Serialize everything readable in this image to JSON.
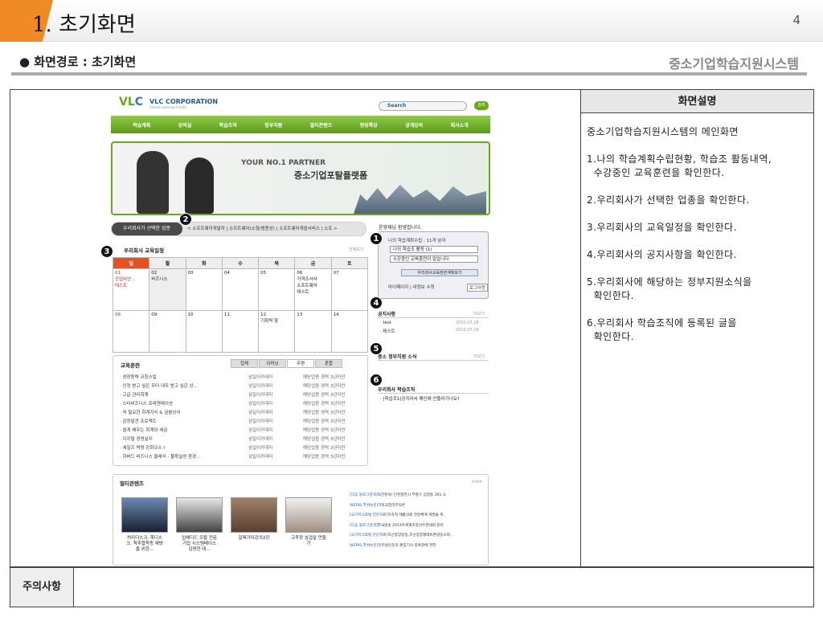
{
  "slide": {
    "title": "1. 초기화면",
    "page": "4",
    "path": "● 화면경로 : 초기화면",
    "system": "중소기업학습지원시스템"
  },
  "desc": {
    "header": "화면설명",
    "lines": [
      "중소기업학습지원시스템의 메인화면",
      "1.나의 학습계획수립현황, 학습조 활동내역,\n  수강중인 교육훈련을 확인한다.",
      "2.우리회사가 선택한 업종을 확인한다.",
      "3.우리회사의 교육일정을 확인한다.",
      "4.우리회사의 공지사항을 확인한다.",
      "5.우리회사에 해당하는 정부지원소식을\n  확인한다.",
      "6.우리회사 학습조직에 등록된 글을\n  확인한다."
    ]
  },
  "note": {
    "label": "주의사항"
  },
  "markers": [
    "1",
    "2",
    "3",
    "4",
    "5",
    "6"
  ],
  "site": {
    "logo_a": "VL",
    "logo_b": "C",
    "corp": "VLC CORPORATION",
    "corp_sub": "Virtual Learning Center",
    "search": "Search",
    "search_btn": "검색",
    "nav": [
      "학습계획",
      "강의실",
      "학습조직",
      "정부지원",
      "멀티콘텐츠",
      "현장특강",
      "공개강의",
      "회사소개"
    ],
    "banner1": "YOUR NO.1 PARTNER",
    "banner2": "중소기업포탈플랫폼",
    "industry_label": "우리회사가 선택한 업종",
    "industry_text": "< 소프트웨어개발자 | 소프트웨어(소형/범용성) | 소프트웨어개발서비스 | 소프 >",
    "schedule_title": "우리회사 교육일정",
    "more": "전체보기",
    "days": [
      "일",
      "월",
      "화",
      "수",
      "목",
      "금",
      "토"
    ],
    "week1": [
      "01\n산업비안 ..\n테스트",
      "02\n비즈니스",
      "03",
      "04",
      "05",
      "06\n가격조사서\n소프트웨어\n테스트",
      "07"
    ],
    "week2": [
      "08",
      "09",
      "10",
      "11",
      "12\n기획력 향",
      "13",
      "14"
    ],
    "welcome": "윤영재님 환영합니다.",
    "plan": "나의 학습계획수립 : 11개 분야",
    "act": "나의 학습조 활동 (1)",
    "course": "수강중인 교육훈련이 없습니다.",
    "gov_btn": "우리회사교육훈련계획보기",
    "mypage": "마이페이지  |  내정보 수정",
    "logout": "로그아웃",
    "notice_title": "공지사항",
    "more2": "더보기",
    "notices": [
      {
        "t": "· test",
        "d": "2010.07.28"
      },
      {
        "t": "· 테스트",
        "d": "2010.07.26"
      }
    ],
    "gov_title": "중소 정부지원 소식",
    "org_title": "우리회사 학습조직",
    "org_item": "· [학습조1]공지라서 메인에 안뜰라가나요?",
    "edu_title": "교육훈련",
    "edu_tabs": [
      "집체",
      "이러닝",
      "우편",
      "혼합"
    ],
    "edu_rows": [
      [
        "· 성장동력 코칭스킬",
        "삼일이카데미",
        "해당업종 경력 3년미만"
      ],
      [
        "· 인정 받고 싶은 무터 대우 받고 싶은 상...",
        "삼일이카데미",
        "해당업종 경력 3년미만"
      ],
      [
        "· 고급 관리회계",
        "삼일이카데미",
        "해당업종 경력 3년미만"
      ],
      [
        "· 스타비즈니스 프레젠테이션",
        "삼일이카데미",
        "해당업종 경력 3년미만"
      ],
      [
        "· 꼭 필요한 회계지식 & 금융상식",
        "삼일이카데미",
        "해당업종 경력 3년미만"
      ],
      [
        "· 감정발견 프로젝트",
        "삼일이카데미",
        "해당업종 경력 3년미만"
      ],
      [
        "· 쉽게 배우는 회계와 세금",
        "삼일이카데미",
        "해당업종 경력 3년미만"
      ],
      [
        "· 디지털 경영실무",
        "삼일이카데미",
        "해당업종 경력 3년미만"
      ],
      [
        "· 세일즈 역량 강화코스 I",
        "삼일이카데미",
        "해당업종 경력 3년미만"
      ],
      [
        "· 하버드 비즈니스 클래식 - 불확실성 환경 ..",
        "삼일이카데미",
        "해당업종 경력 3년미만"
      ]
    ],
    "mm_title": "멀티콘텐츠",
    "mm_more": "more",
    "mm_caps": [
      "허리디스크, 목디스\n크, 척추협착증 예방\n을 위한...",
      "입베디드 모듈 전문\n기업 시스템베이스\n김영한 대...",
      "일렉기타강의2강",
      "고추장 삼겹살 만들\n기"
    ],
    "news": [
      [
        "[다음 블로그검색]",
        "덕건분석) 인천항만시 부평구 십정동 361-3,"
      ],
      [
        "[KERIS 학위논문]",
        "기독교합리주의론"
      ],
      [
        "[국가지식포털 전문자료]",
        "지속적 재활의료 전달체계 개발을 위,"
      ],
      [
        "[다음 블로그검색]",
        "한국방송 2013주세계조정선수권대회 준비"
      ],
      [
        "[국가지식포털 전문자료]",
        "조선중앙방송,조선중앙텔레비죤방송소외,"
      ],
      [
        "[KERIS 학위논문]",
        "인터넷신문의 편집기사 중복관에 관한"
      ]
    ]
  }
}
